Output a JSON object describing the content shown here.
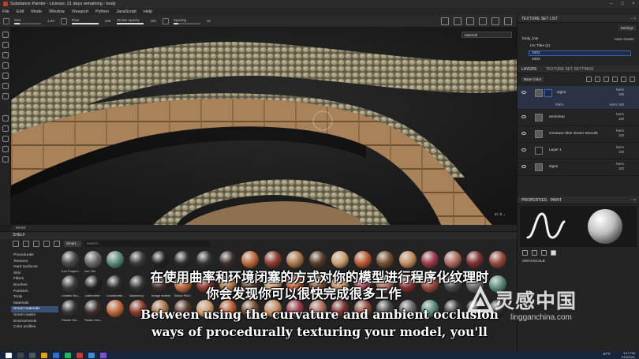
{
  "window": {
    "title": "Substance Painter - License: 21 days remaining - body"
  },
  "menu": [
    "File",
    "Edit",
    "Mode",
    "Window",
    "Viewport",
    "Python",
    "JavaScript",
    "Help"
  ],
  "toolbar": {
    "size_label": "Size",
    "size_value": "1.93",
    "flow_label": "Flow",
    "flow_value": "100",
    "stroke_opacity_label": "Stroke opacity",
    "stroke_opacity_value": "100",
    "spacing_label": "Spacing",
    "spacing_value": "18"
  },
  "viewport": {
    "mode_dropdown": "Material"
  },
  "status": {
    "mask_label": "MASK"
  },
  "shelf": {
    "title": "SHELF",
    "filter_chip": "Smart...",
    "search_placeholder": "Search...",
    "categories": [
      "Procedurals",
      "Textures",
      "Hard Surfaces",
      "Skin",
      "Filters",
      "Brushes",
      "Particles",
      "Tools",
      "Materials",
      "Smart materials",
      "Smart masks",
      "Environments",
      "Color profiles"
    ],
    "active_category": "Smart materials",
    "materials_row1": [
      "Iron Forged...",
      "Iron Old",
      "",
      "",
      "",
      "",
      "",
      "",
      "",
      "",
      "",
      "",
      "",
      "",
      "",
      "",
      "",
      "",
      "",
      ""
    ],
    "materials_row2": [
      "Leather Wo...",
      "Leatherette",
      "Leatherette...",
      "Machinery",
      "Image leather",
      "Shield Pitch",
      "",
      "",
      "",
      "",
      "",
      "",
      "",
      "",
      "",
      "",
      "",
      "",
      "",
      ""
    ],
    "materials_row3": [
      "Plastic Glo...",
      "Plastic Hea...",
      "",
      "",
      "",
      "",
      "",
      "",
      "",
      "",
      "",
      "",
      "",
      "",
      "",
      "",
      "",
      "",
      "",
      ""
    ]
  },
  "texture_set_list": {
    "title": "TEXTURE SET LIST",
    "settings": "Settings",
    "set_name": "body_low",
    "shader": "Main shader",
    "uv_tiles": "UV Tiles (2)",
    "tiles": [
      "1001",
      "1002"
    ]
  },
  "layers": {
    "tab_layers": "LAYERS",
    "tab_tss": "TEXTURE SET SETTINGS",
    "blend_dropdown": "Base Color",
    "items": [
      {
        "name": "signs",
        "mode": "Norm",
        "opacity": "100",
        "sub": "Paint",
        "sub_mode": "Norm",
        "sub_opacity": "100"
      },
      {
        "name": "amniotop",
        "mode": "Norm",
        "opacity": "100"
      },
      {
        "name": "Creature Skin Green Smooth",
        "mode": "Norm",
        "opacity": "100"
      },
      {
        "name": "Layer 1",
        "mode": "Norm",
        "opacity": "100"
      },
      {
        "name": "signs",
        "mode": "Norm",
        "opacity": "100"
      }
    ]
  },
  "properties": {
    "title": "PROPERTIES - PAINT",
    "section": "GRAYSCALE"
  },
  "taskbar": {
    "weather": "87°F",
    "clock_time": "3:17 PM",
    "clock_date": "7/22/2021"
  },
  "subtitles": {
    "zh_line1": "在使用曲率和环境闭塞的方式对你的模型进行程序化纹理时",
    "zh_line2": "你会发现你可以很快完成很多工作",
    "en_line1": "Between using the curvature and ambient occlusion",
    "en_line2": "ways of procedurally texturing your model, you'll"
  },
  "watermark": {
    "text": "灵感中国",
    "url": "lingganchina.com"
  },
  "colors": {
    "accent": "#3b64b3",
    "selection": "#2a3345",
    "taskbar": "#17243a"
  }
}
